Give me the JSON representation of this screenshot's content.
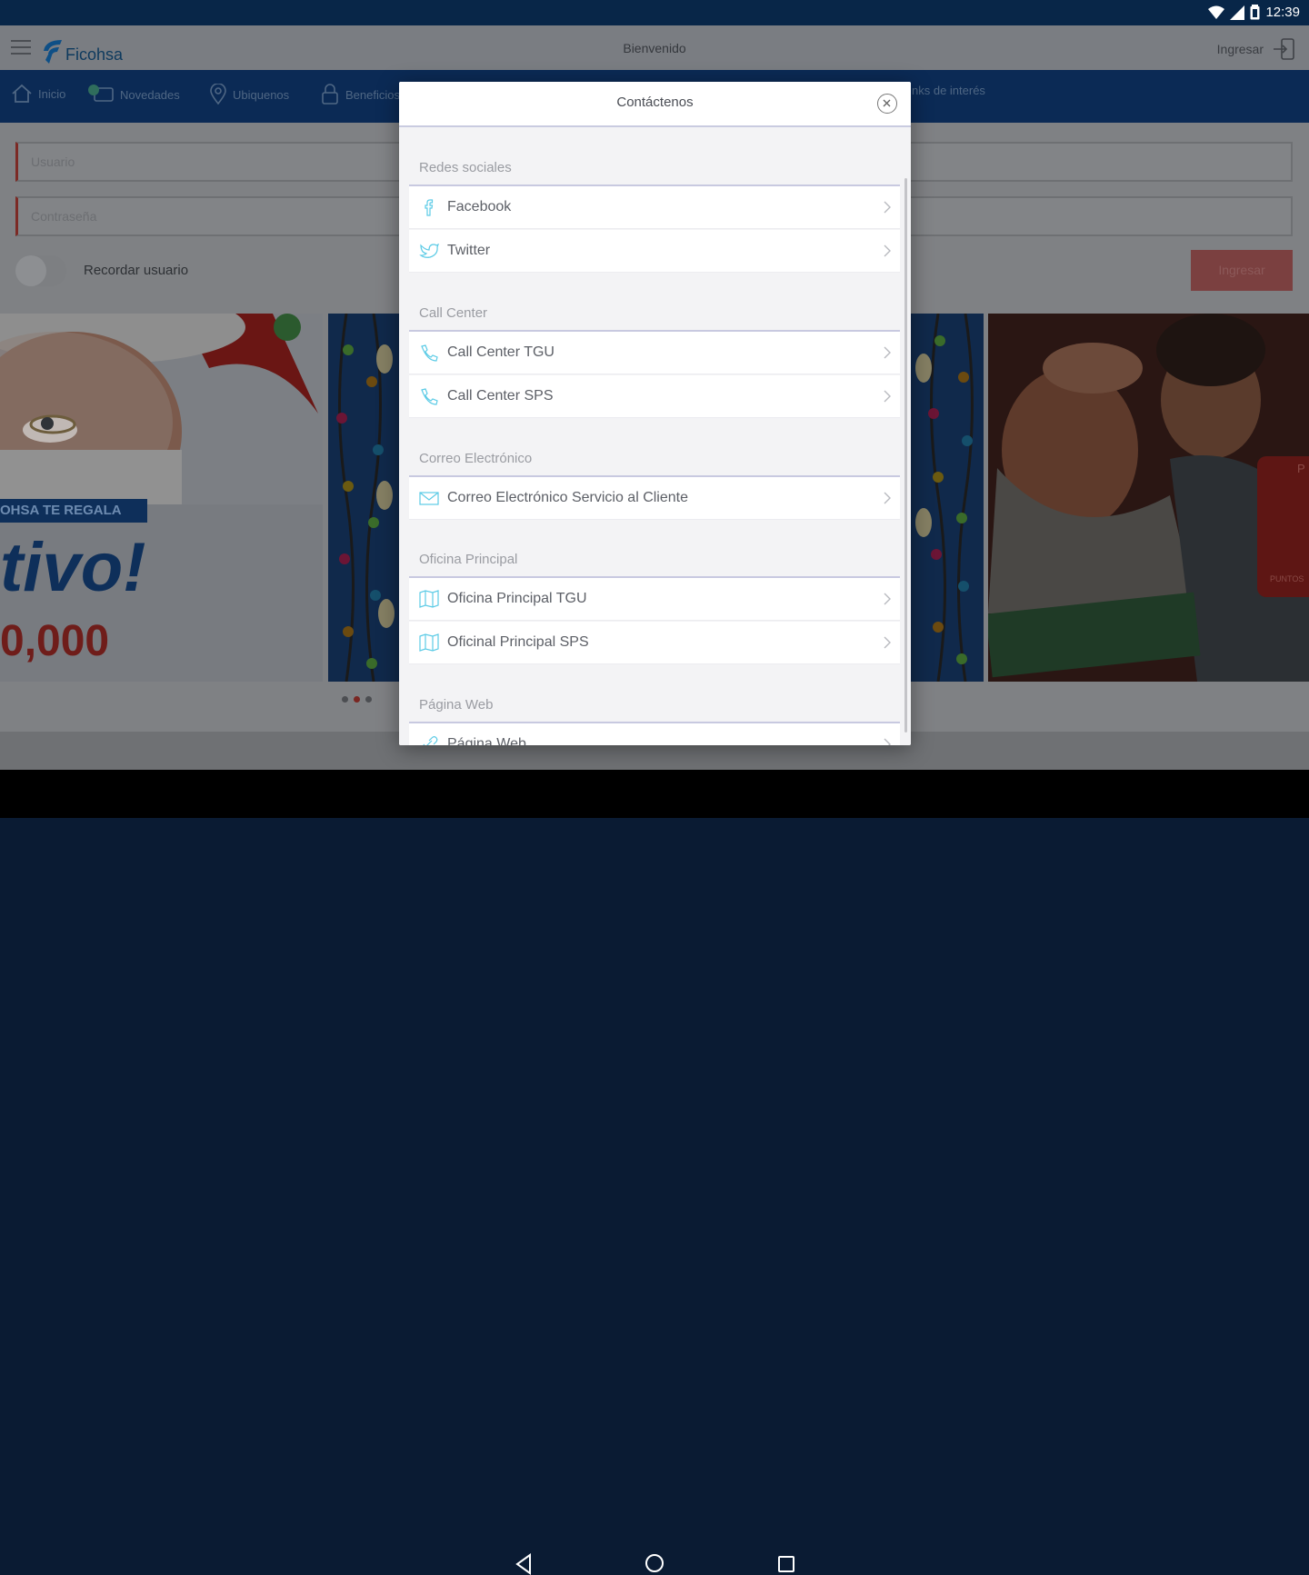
{
  "status_bar": {
    "time": "12:39"
  },
  "header": {
    "brand": "Ficohsa",
    "welcome": "Bienvenido",
    "login_link": "Ingresar"
  },
  "nav": {
    "items": [
      {
        "label": "Inicio",
        "icon": "home-icon"
      },
      {
        "label": "Novedades",
        "icon": "chat-icon"
      },
      {
        "label": "Ubiquenos",
        "icon": "location-pin-icon"
      },
      {
        "label": "Beneficios",
        "icon": "lock-icon"
      },
      {
        "label": "nks de interés",
        "icon": ""
      }
    ]
  },
  "login": {
    "username_placeholder": "Usuario",
    "password_placeholder": "Contraseña",
    "remember_label": "Recordar usuario",
    "submit_label": "Ingresar"
  },
  "banners": {
    "santa_tag": "OHSA TE REGALA",
    "santa_headline": "tivo!",
    "santa_amount": "0,000",
    "couple_badge_top": "P",
    "couple_badge_bottom": "PUNTOS"
  },
  "modal": {
    "title": "Contáctenos",
    "sections": [
      {
        "title": "Redes sociales",
        "items": [
          {
            "label": "Facebook",
            "icon": "facebook-icon"
          },
          {
            "label": "Twitter",
            "icon": "twitter-icon"
          }
        ]
      },
      {
        "title": "Call Center",
        "items": [
          {
            "label": "Call Center TGU",
            "icon": "phone-icon"
          },
          {
            "label": "Call Center SPS",
            "icon": "phone-icon"
          }
        ]
      },
      {
        "title": "Correo Electrónico",
        "items": [
          {
            "label": "Correo Electrónico Servicio al Cliente",
            "icon": "mail-icon"
          }
        ]
      },
      {
        "title": "Oficina Principal",
        "items": [
          {
            "label": "Oficina Principal TGU",
            "icon": "map-icon"
          },
          {
            "label": "Oficinal Principal SPS",
            "icon": "map-icon"
          }
        ]
      },
      {
        "title": "Página Web",
        "items": [
          {
            "label": "Página Web",
            "icon": "link-icon"
          }
        ]
      }
    ]
  },
  "colors": {
    "brand_navy": "#0b2a55",
    "status_bar": "#082648",
    "accent_cyan": "#5ccbe6",
    "alert_red": "#c7302a",
    "divider_lavender": "#c8c9e0"
  }
}
